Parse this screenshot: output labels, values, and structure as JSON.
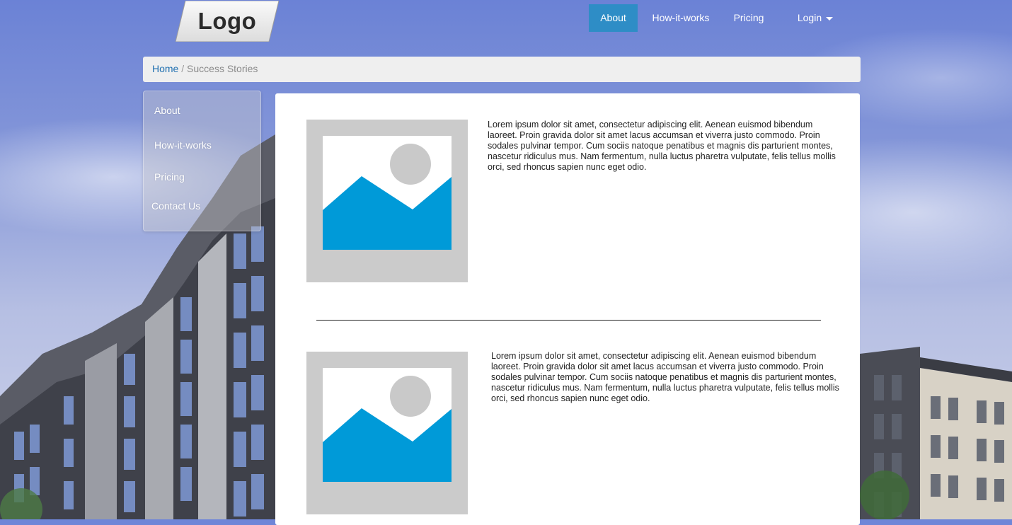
{
  "header": {
    "logo_text": "Logo",
    "nav": [
      {
        "label": "About",
        "active": true
      },
      {
        "label": "How-it-works",
        "active": false
      },
      {
        "label": "Pricing",
        "active": false
      },
      {
        "label": "Login",
        "active": false,
        "dropdown": true
      }
    ]
  },
  "breadcrumb": {
    "home": "Home",
    "separator": "/",
    "current": "Success Stories"
  },
  "sidebar": {
    "items": [
      {
        "label": "About"
      },
      {
        "label": "How-it-works"
      },
      {
        "label": "Pricing"
      },
      {
        "label": "Contact Us"
      }
    ]
  },
  "stories": [
    {
      "image_icon": "image-placeholder-icon",
      "text": "Lorem ipsum dolor sit amet, consectetur adipiscing elit. Aenean euismod bibendum laoreet. Proin gravida dolor sit amet lacus accumsan et viverra justo commodo. Proin sodales pulvinar tempor. Cum sociis natoque penatibus et magnis dis parturient montes, nascetur ridiculus mus. Nam fermentum, nulla luctus pharetra vulputate, felis tellus mollis orci, sed rhoncus sapien nunc eget odio."
    },
    {
      "image_icon": "image-placeholder-icon",
      "text": "Lorem ipsum dolor sit amet, consectetur adipiscing elit. Aenean euismod bibendum laoreet. Proin gravida dolor sit amet lacus accumsan et viverra justo commodo. Proin sodales pulvinar tempor. Cum sociis natoque penatibus et magnis dis parturient montes, nascetur ridiculus mus. Nam fermentum, nulla luctus pharetra vulputate, felis tellus mollis orci, sed rhoncus sapien nunc eget odio."
    }
  ],
  "colors": {
    "nav_active": "#2e8dc6",
    "link": "#1f6fb0",
    "placeholder_frame": "#cbcbcb",
    "placeholder_mountain": "#009ad8",
    "placeholder_sun": "#c9c9c9"
  }
}
